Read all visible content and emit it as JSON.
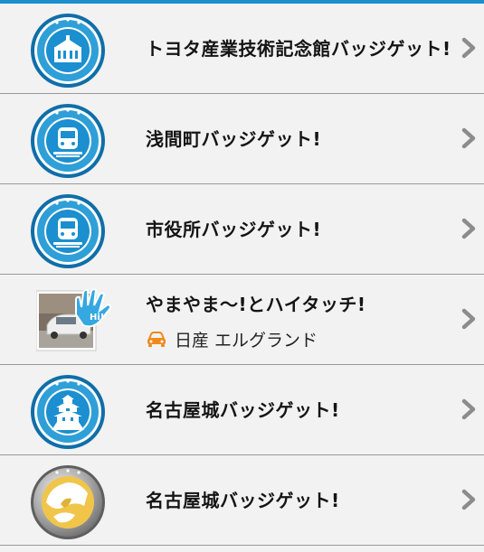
{
  "colors": {
    "accent": "#1b8fcf",
    "badge_blue": "#2f9fd8",
    "badge_dark": "#0f6ea8",
    "chevron": "#8c8c8c",
    "car_icon": "#f08a1c"
  },
  "items": [
    {
      "title": "トヨタ産業技術記念館バッジゲット!",
      "icon": "museum-badge-icon"
    },
    {
      "title": "浅間町バッジゲット!",
      "icon": "train-badge-icon"
    },
    {
      "title": "市役所バッジゲット!",
      "icon": "train-badge-icon"
    },
    {
      "title": "やまやま～!とハイタッチ!",
      "subtitle": "日産 エルグランド",
      "icon": "high-five-photo",
      "badge_text": "Hi!"
    },
    {
      "title": "名古屋城バッジゲット!",
      "icon": "castle-badge-icon"
    },
    {
      "title": "名古屋城バッジゲット!",
      "icon": "castle-silver-badge-icon"
    }
  ]
}
